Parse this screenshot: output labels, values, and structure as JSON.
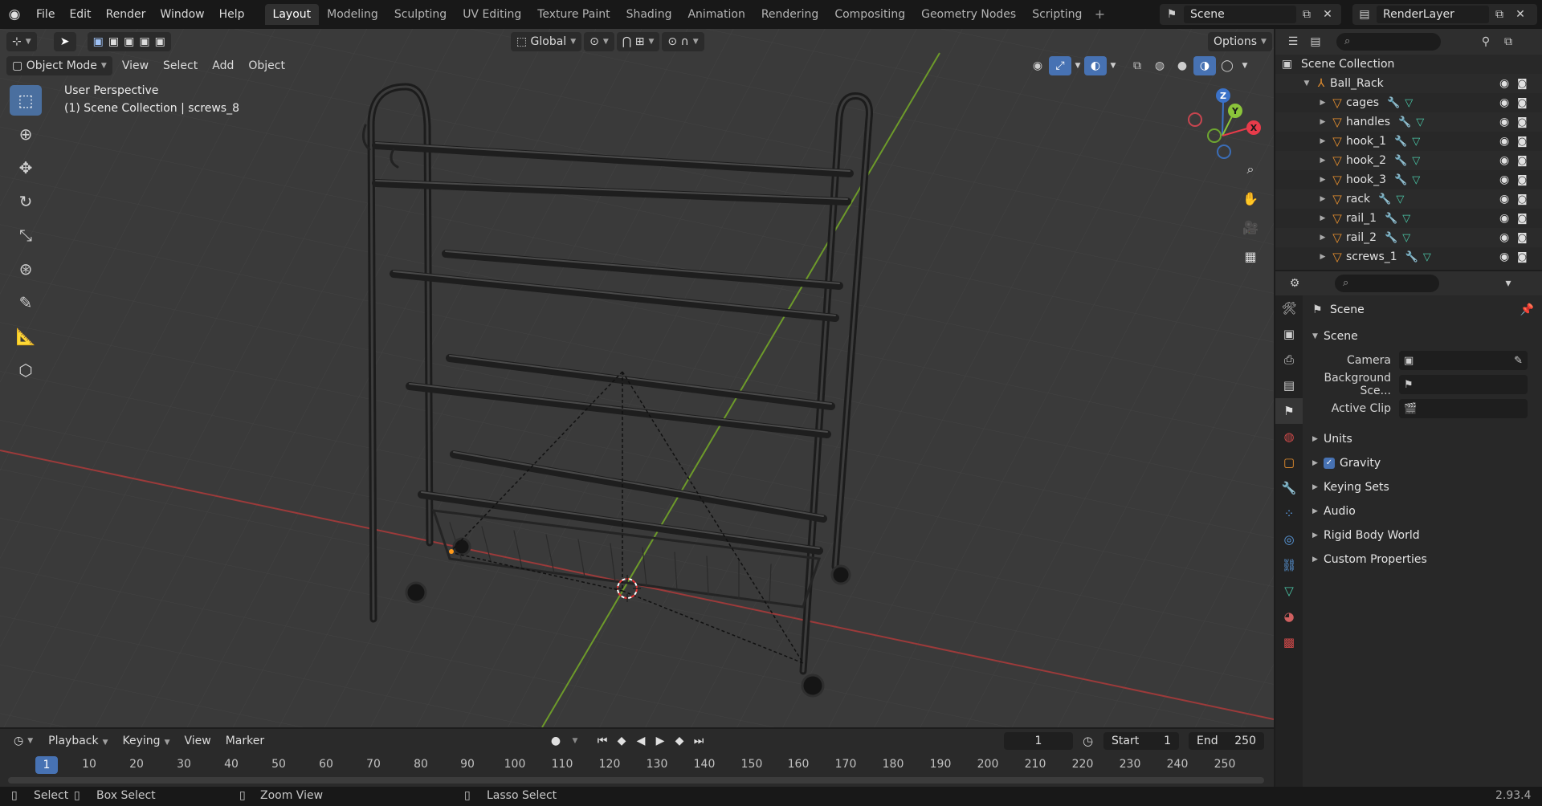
{
  "menu": [
    "File",
    "Edit",
    "Render",
    "Window",
    "Help"
  ],
  "workspaces": [
    "Layout",
    "Modeling",
    "Sculpting",
    "UV Editing",
    "Texture Paint",
    "Shading",
    "Animation",
    "Rendering",
    "Compositing",
    "Geometry Nodes",
    "Scripting"
  ],
  "active_workspace": "Layout",
  "scene_name": "Scene",
  "view_layer_name": "RenderLayer",
  "viewport": {
    "mode": "Object Mode",
    "menus": [
      "View",
      "Select",
      "Add",
      "Object"
    ],
    "transform_orientation": "Global",
    "options_label": "Options",
    "info_line1": "User Perspective",
    "info_line2": "(1) Scene Collection | screws_8",
    "gizmo_labels": {
      "x": "X",
      "y": "Y",
      "z": "Z"
    }
  },
  "outliner": {
    "root": "Scene Collection",
    "collection": "Ball_Rack",
    "objects": [
      "cages",
      "handles",
      "hook_1",
      "hook_2",
      "hook_3",
      "rack",
      "rail_1",
      "rail_2",
      "screws_1"
    ]
  },
  "properties": {
    "context_title": "Scene",
    "panel_title": "Scene",
    "fields": [
      {
        "label": "Camera",
        "value": ""
      },
      {
        "label": "Background Sce...",
        "value": ""
      },
      {
        "label": "Active Clip",
        "value": ""
      }
    ],
    "subpanels": [
      "Units",
      "Gravity",
      "Keying Sets",
      "Audio",
      "Rigid Body World",
      "Custom Properties"
    ],
    "gravity_checked": true
  },
  "timeline": {
    "menus": [
      "Playback",
      "Keying",
      "View",
      "Marker"
    ],
    "current_frame": "1",
    "start_label": "Start",
    "start_value": "1",
    "end_label": "End",
    "end_value": "250",
    "ruler": [
      "10",
      "20",
      "30",
      "40",
      "50",
      "60",
      "70",
      "80",
      "90",
      "100",
      "110",
      "120",
      "130",
      "140",
      "150",
      "160",
      "170",
      "180",
      "190",
      "200",
      "210",
      "220",
      "230",
      "240",
      "250"
    ]
  },
  "status": {
    "select": "Select",
    "box_select": "Box Select",
    "zoom_view": "Zoom View",
    "lasso_select": "Lasso Select",
    "version": "2.93.4"
  },
  "colors": {
    "accent": "#4772b3",
    "x_axis": "#9c3a3a",
    "y_axis": "#6d9a2a",
    "object_icon": "#e8902e"
  }
}
